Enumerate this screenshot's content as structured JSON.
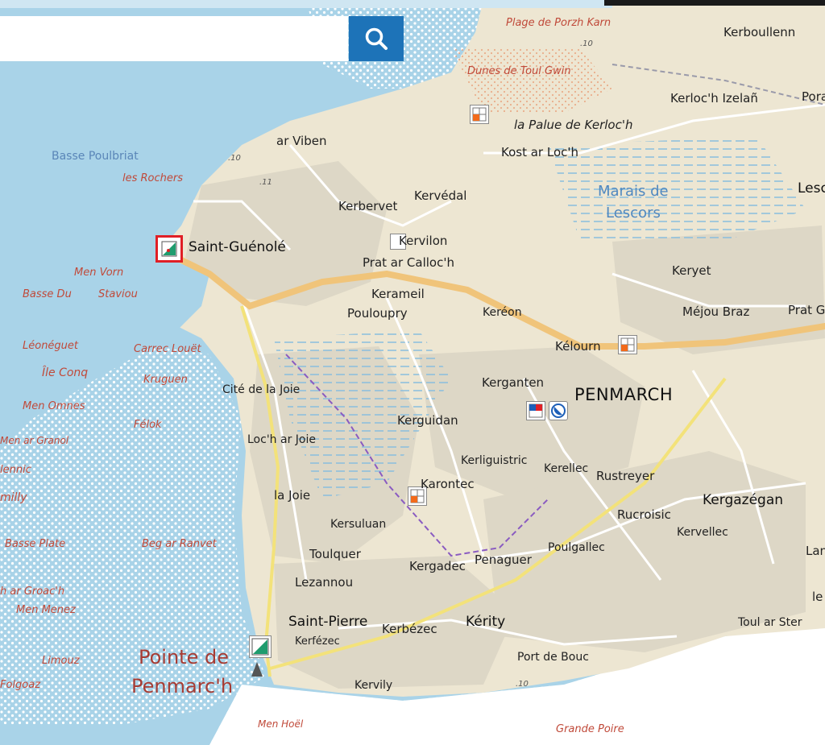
{
  "search": {
    "placeholder": "",
    "value": "",
    "button_icon": "search-icon"
  },
  "colors": {
    "sea": "#a9d3e8",
    "land": "#ede6d2",
    "built": "#ddd7c6",
    "main_road": "#f0c47a",
    "route_dash": "#8a5bc1",
    "search_button": "#1d73b8",
    "selection": "#e01f26"
  },
  "labels": {
    "plage_porzh_karn": "Plage de Porzh Karn",
    "dunes_toul_gwin": "Dunes de Toul Gwin",
    "kerboullenn": "Kerboullenn",
    "poraz": "Poraz",
    "kerloch_izelan": "Kerloc'h Izelañ",
    "palue_kerloch": "la Palue de Kerloc'h",
    "kost_ar_loch": "Kost ar Loc'h",
    "ar_viben": "ar Viben",
    "basse_poulbriat": "Basse Poulbriat",
    "les_rochers": "les Rochers",
    "marais_de": "Marais de",
    "lescors": "Lescors",
    "lesc": "Lesc",
    "kerbervet": "Kerbervet",
    "kervedal": "Kervédal",
    "kervilon": "Kervilon",
    "saint_guenole": "Saint-Guénolé",
    "prat_ar_calloch": "Prat ar Calloc'h",
    "keryet": "Keryet",
    "men_vorn": "Men Vorn",
    "staviou": "Staviou",
    "basse_du": "Basse Du",
    "kerameil": "Kerameil",
    "pouloupry": "Pouloupry",
    "kereon": "Keréon",
    "mejou_braz": "Méjou Braz",
    "prat_go": "Prat Go",
    "leoneguet": "Léonéguet",
    "carrec_louet": "Carrec Louët",
    "kelourn": "Kélourn",
    "ile_conq": "Île Conq",
    "kruguen": "Kruguen",
    "cite_de_la_joie": "Cité de la Joie",
    "kerganten": "Kerganten",
    "penmarch": "PENMARCH",
    "men_omnes": "Men Omnes",
    "felok": "Félok",
    "kerguidan": "Kerguidan",
    "men_ar_granol": "Men ar Granol",
    "loch_ar_joie": "Loc'h ar Joie",
    "kerliguistric": "Kerliguistric",
    "kerellec": "Kerellec",
    "rustreyer": "Rustreyer",
    "lennic": "lennic",
    "karontec": "Karontec",
    "milly": "milly",
    "la_joie": "la Joie",
    "kergazegan": "Kergazégan",
    "rucroisic": "Rucroisic",
    "kersuluan": "Kersuluan",
    "kervellec": "Kervellec",
    "basse_plate": "Basse Plate",
    "beg_ar_ranvet": "Beg ar Ranvet",
    "poulgallec": "Poulgallec",
    "lan": "Lan",
    "toulquer": "Toulquer",
    "kergadec": "Kergadec",
    "penaguer": "Penaguer",
    "lezannou": "Lezannou",
    "h_ar_groach": "h ar Groac'h",
    "le": "le",
    "men_menez": "Men Menez",
    "saint_pierre": "Saint-Pierre",
    "kerbezec": "Kerbézec",
    "kerity": "Kérity",
    "toul_ar_ster": "Toul ar Ster",
    "kerfezec": "Kerfézec",
    "pointe_de": "Pointe de",
    "penmarch_cape": "Penmarc'h",
    "limouz": "Limouz",
    "port_de_bouc": "Port de Bouc",
    "folgoaz": "Folgoaz",
    "kervily": "Kervily",
    "men_hoel": "Men Hoël",
    "grande_poire": "Grande Poire",
    "spot_10a": ".10",
    "spot_10b": ".10",
    "spot_11": ".11",
    "spot_10c": ".10"
  }
}
